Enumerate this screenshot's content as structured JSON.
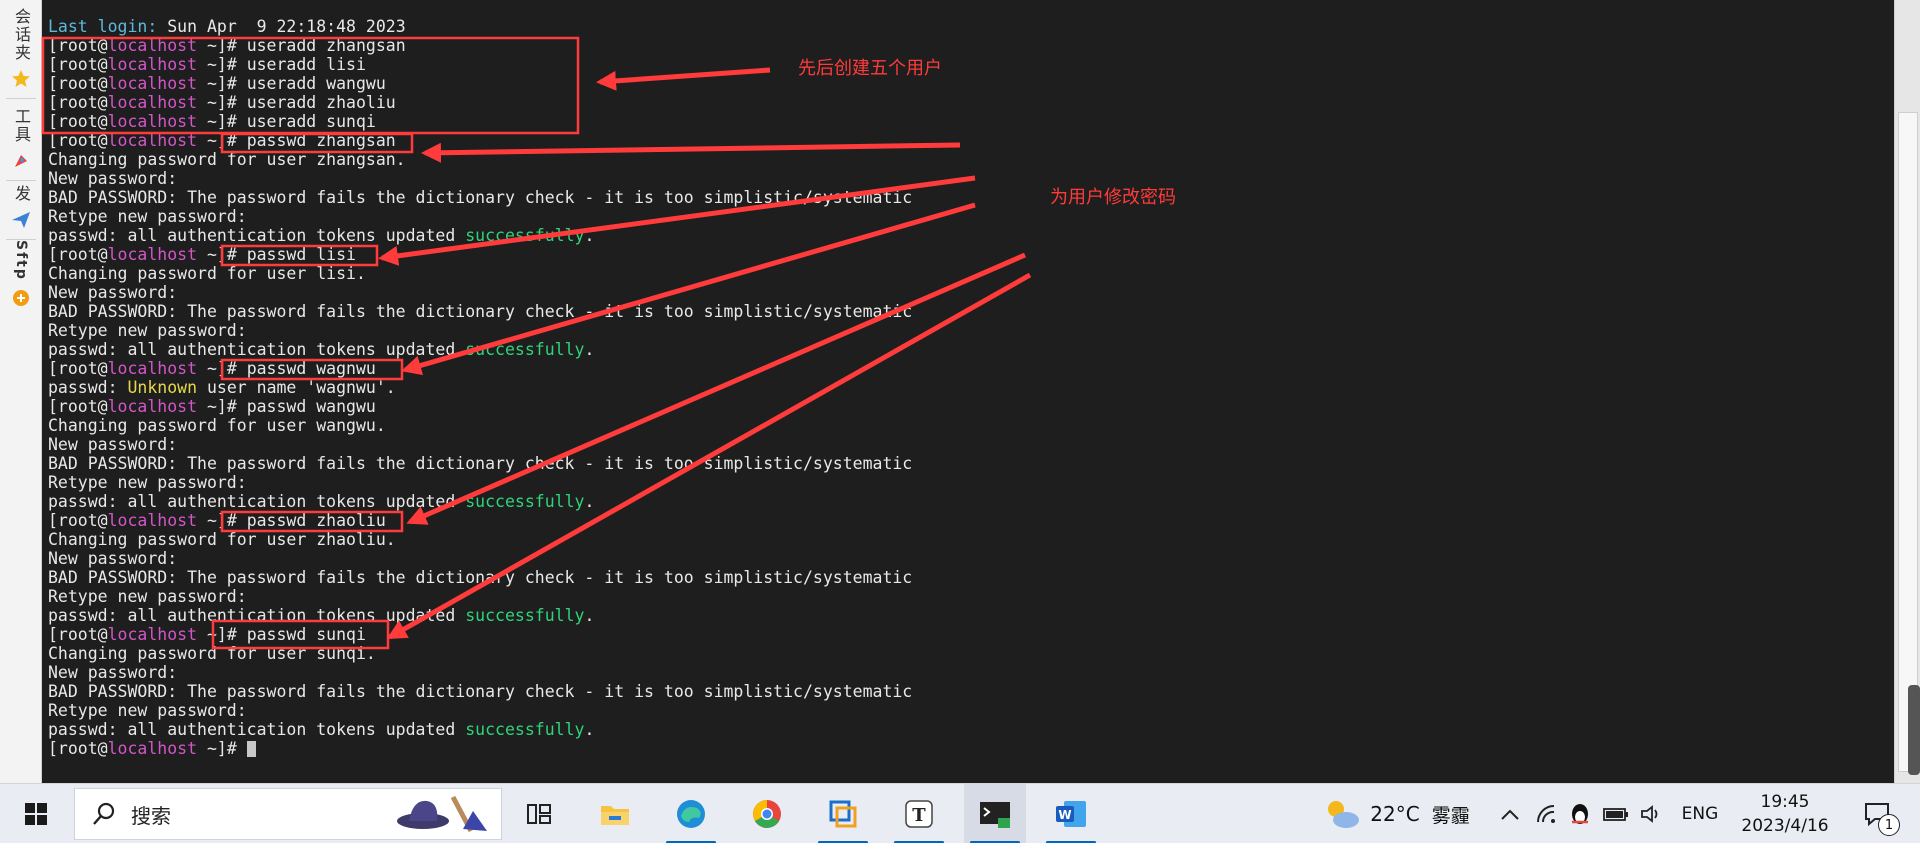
{
  "sidebar": {
    "tabs": [
      {
        "label": "会话夹",
        "icon": "star-icon"
      },
      {
        "label": "工具",
        "icon": "rocket-icon"
      },
      {
        "label": "发",
        "icon": "send-icon"
      },
      {
        "label": "Sftp",
        "icon": "sftp-icon"
      }
    ]
  },
  "terminal": {
    "last_login_label": "Last login:",
    "last_login_value": " Sun Apr  9 22:18:48 2023",
    "prompt_open": "[root@",
    "prompt_host": "localhost",
    "prompt_close": " ~]# ",
    "commands": {
      "useradd_zhangsan": "useradd zhangsan",
      "useradd_lisi": "useradd lisi",
      "useradd_wangwu": "useradd wangwu",
      "useradd_zhaoliu": "useradd zhaoliu",
      "useradd_sunqi": "useradd sunqi",
      "passwd_zhangsan": "passwd zhangsan",
      "passwd_lisi": "passwd lisi",
      "passwd_wagnwu": "passwd wagnwu",
      "passwd_wangwu": "passwd wangwu",
      "passwd_zhaoliu": "passwd zhaoliu",
      "passwd_sunqi": "passwd sunqi"
    },
    "output": {
      "changing_zhangsan": "Changing password for user zhangsan.",
      "changing_lisi": "Changing password for user lisi.",
      "changing_wangwu": "Changing password for user wangwu.",
      "changing_zhaoliu": "Changing password for user zhaoliu.",
      "changing_sunqi": "Changing password for user sunqi.",
      "new_password": "New password:",
      "bad_password": "BAD PASSWORD: The password fails the dictionary check - it is too simplistic/systematic",
      "retype": "Retype new password:",
      "updated_prefix": "passwd: all authentication tokens updated ",
      "updated_success": "successfully",
      "updated_suffix": ".",
      "unknown_prefix": "passwd: ",
      "unknown_word": "Unknown",
      "unknown_suffix": " user name 'wagnwu'."
    }
  },
  "annotations": {
    "create_users": "先后创建五个用户",
    "change_passwords": "为用户修改密码"
  },
  "taskbar": {
    "search_placeholder": "搜索",
    "weather_temp": "22°C",
    "weather_desc": "雾霾",
    "language": "ENG",
    "time": "19:45",
    "date": "2023/4/16",
    "notification_count": "1",
    "apps": [
      {
        "name": "task-view",
        "icon": "task-view-icon"
      },
      {
        "name": "file-explorer",
        "icon": "folder-icon"
      },
      {
        "name": "edge",
        "icon": "edge-icon"
      },
      {
        "name": "chrome",
        "icon": "chrome-icon"
      },
      {
        "name": "vmware",
        "icon": "vmware-icon"
      },
      {
        "name": "typora",
        "icon": "typora-icon"
      },
      {
        "name": "terminal",
        "icon": "terminal-icon"
      },
      {
        "name": "word",
        "icon": "word-icon"
      }
    ]
  },
  "colors": {
    "prompt_host": "#d455c8",
    "success": "#2ed47a",
    "warning": "#e5d84a",
    "login": "#5fb8d8",
    "annotation": "#ff3b3b"
  }
}
